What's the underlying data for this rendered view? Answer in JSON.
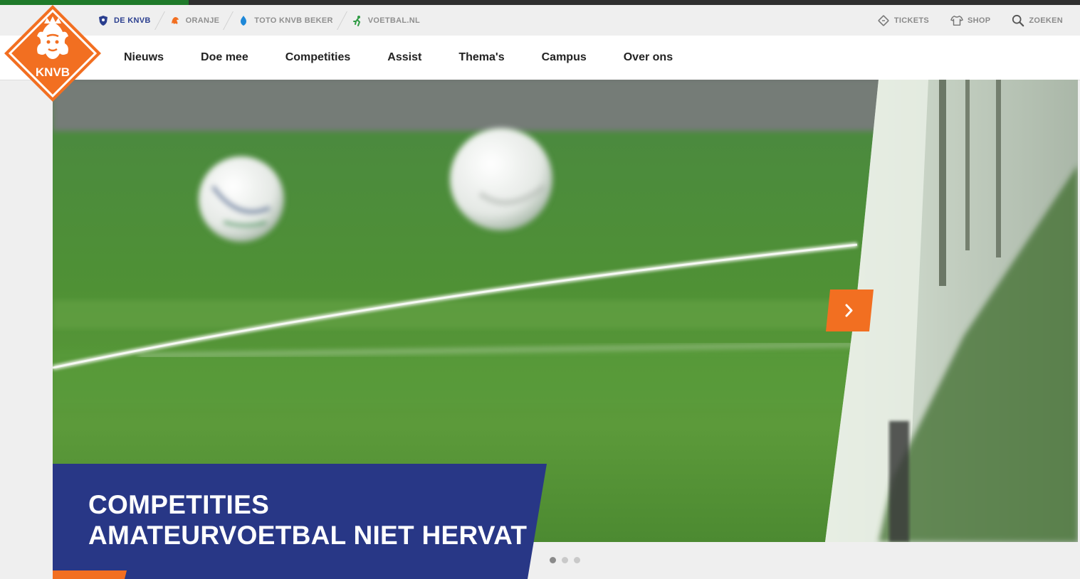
{
  "utility": {
    "links": [
      {
        "label": "DE KNVB",
        "icon": "knvb-shield-icon",
        "active": true
      },
      {
        "label": "ORANJE",
        "icon": "lion-icon",
        "active": false
      },
      {
        "label": "TOTO KNVB BEKER",
        "icon": "cup-icon",
        "active": false
      },
      {
        "label": "VOETBAL.NL",
        "icon": "player-icon",
        "active": false
      }
    ],
    "right": [
      {
        "label": "TICKETS",
        "icon": "ticket-icon"
      },
      {
        "label": "SHOP",
        "icon": "shirt-icon"
      },
      {
        "label": "ZOEKEN",
        "icon": "search-icon"
      }
    ]
  },
  "nav": {
    "items": [
      "Nieuws",
      "Doe mee",
      "Competities",
      "Assist",
      "Thema's",
      "Campus",
      "Over ons"
    ]
  },
  "logo": {
    "text": "KNVB"
  },
  "hero": {
    "headline_line1": "COMPETITIES",
    "headline_line2": "AMATEURVOETBAL NIET HERVAT",
    "slide_count": 3,
    "active_slide": 1
  },
  "colors": {
    "knvb_orange": "#f26f21",
    "navy": "#283786",
    "active_link": "#2b3f8f"
  }
}
